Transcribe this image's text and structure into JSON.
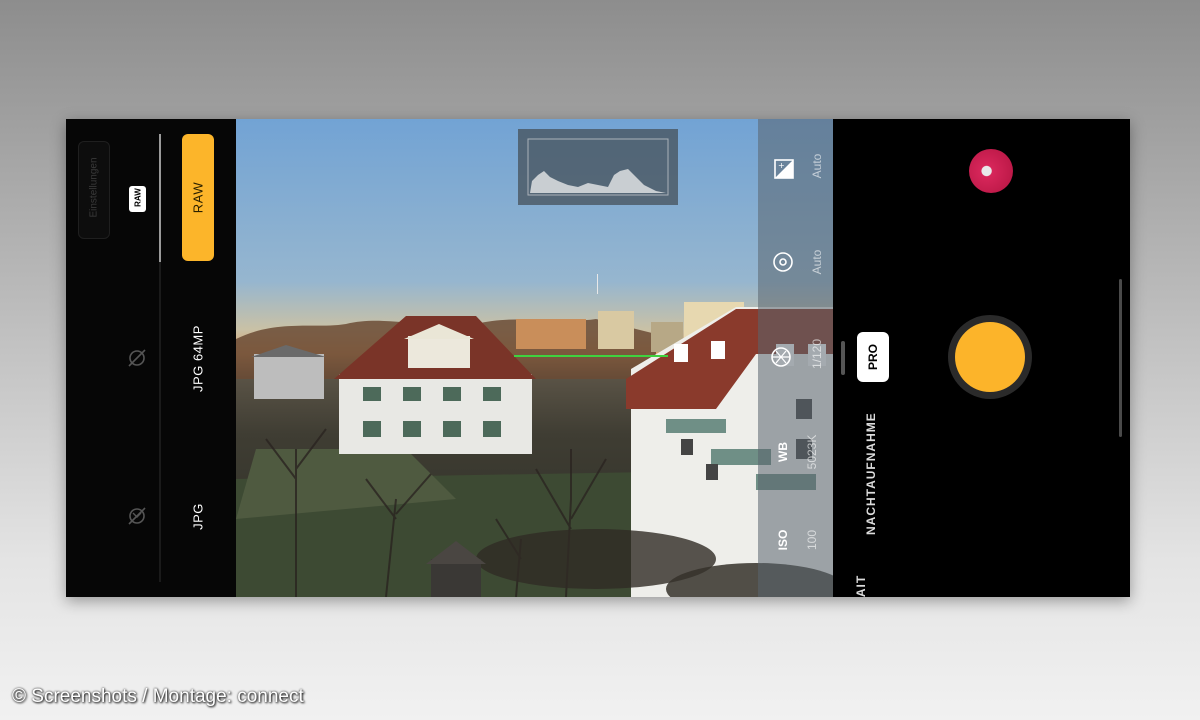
{
  "left_panel": {
    "settings_label": "Einstellungen",
    "raw_badge": "RAW",
    "raw_button": "RAW",
    "format_options": [
      "JPG 64MP",
      "JPG"
    ],
    "icons": [
      "camera-off-icon",
      "no-filter-icon"
    ]
  },
  "viewfinder": {
    "overlay": {
      "exposure_value": "Auto",
      "focus_value": "Auto",
      "shutter_value": "1/120",
      "wb_label": "WB",
      "wb_value": "5023K",
      "iso_label": "ISO",
      "iso_value": "100"
    },
    "icons": [
      "exposure-compensation-icon",
      "focus-target-icon",
      "aperture-icon"
    ]
  },
  "right_panel": {
    "modes": [
      "PRO",
      "NACHTAUFNAHME",
      "PORTRAIT"
    ],
    "active_mode": "PRO",
    "visible_partial_mode": "AIT"
  },
  "colors": {
    "accent": "#fcb52a",
    "focus_peaking": "#3fd23f",
    "thumbnail": "#c41d4d"
  },
  "credit": "© Screenshots / Montage: connect"
}
